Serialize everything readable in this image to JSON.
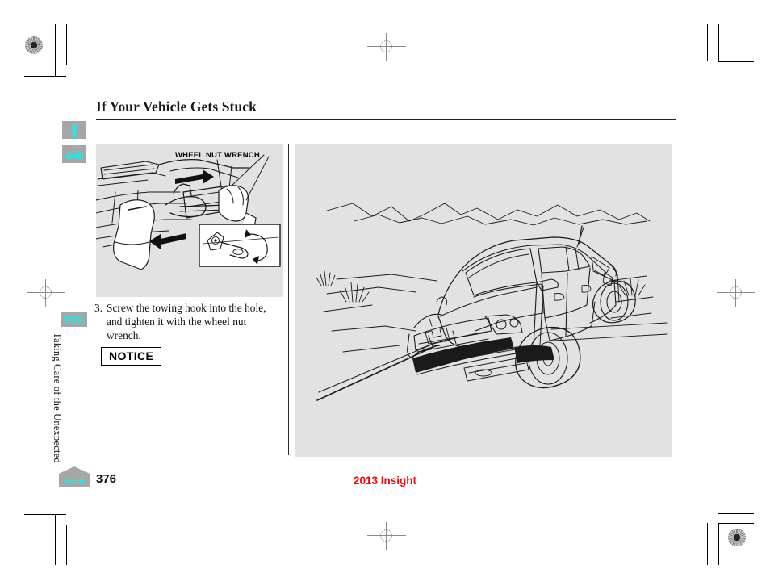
{
  "document": {
    "title": "If Your Vehicle Gets Stuck",
    "page_number": "376",
    "footer_model": "2013 Insight",
    "section_label": "Taking Care of the Unexpected"
  },
  "sidebar": {
    "info_icon": "info-icon",
    "vehicle_icon": "car-icon",
    "toc_label": "TOC",
    "home_label": "Home"
  },
  "figures": {
    "left": {
      "callout": "WHEEL NUT WRENCH",
      "name": "towing-hook-installation-illustration",
      "background": "#e2e2e2"
    },
    "right": {
      "name": "vehicle-being-towed-illustration",
      "background": "#e2e2e2"
    }
  },
  "content": {
    "step_number": "3.",
    "step_text": "Screw the towing hook into the hole, and tighten it with the wheel nut wrench.",
    "notice_label": "NOTICE"
  },
  "colors": {
    "accent_cyan": "#25e7e7",
    "tab_gray": "#a6a6a6",
    "figure_gray": "#e2e2e2",
    "footer_red": "#ff0000",
    "text_black": "#111111"
  }
}
